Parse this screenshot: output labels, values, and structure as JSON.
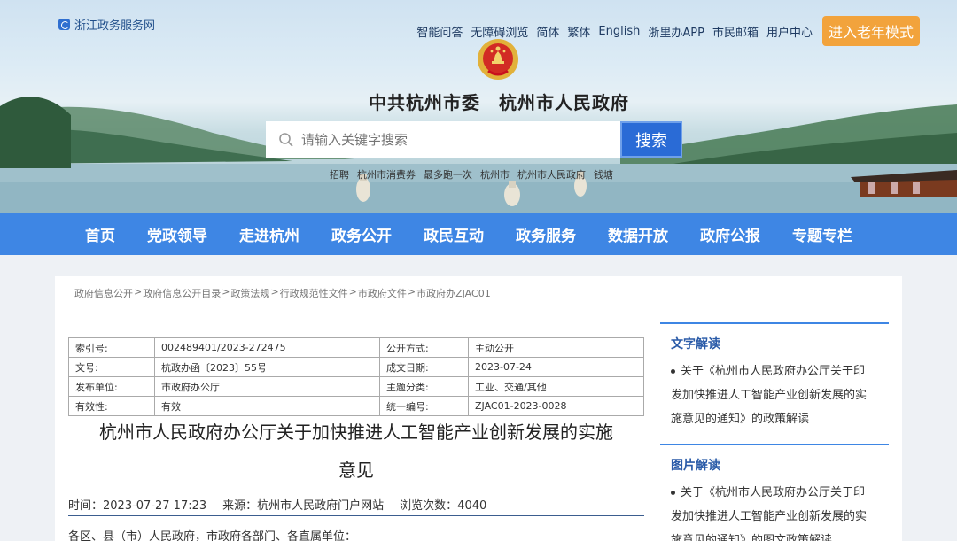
{
  "header": {
    "site_logo": "浙江政务服务网",
    "top_links": [
      "智能问答",
      "无障碍浏览",
      "简体",
      "繁体",
      "English",
      "浙里办APP",
      "市民邮箱",
      "用户中心"
    ],
    "elder_mode": "进入老年模式",
    "title": "中共杭州市委　杭州市人民政府",
    "search_placeholder": "请输入关键字搜索",
    "search_button": "搜索",
    "hot_words": [
      "招聘",
      "杭州市消费券",
      "最多跑一次",
      "杭州市",
      "杭州市人民政府",
      "钱塘"
    ]
  },
  "nav": {
    "items": [
      "首页",
      "党政领导",
      "走进杭州",
      "政务公开",
      "政民互动",
      "政务服务",
      "数据开放",
      "政府公报",
      "专题专栏"
    ]
  },
  "breadcrumb": [
    "政府信息公开",
    "政府信息公开目录",
    "政策法规",
    "行政规范性文件",
    "市政府文件",
    "市政府办ZJAC01"
  ],
  "meta": {
    "rows": [
      [
        "索引号:",
        "002489401/2023-272475",
        "公开方式:",
        "主动公开"
      ],
      [
        "文号:",
        "杭政办函〔2023〕55号",
        "成文日期:",
        "2023-07-24"
      ],
      [
        "发布单位:",
        "市政府办公厅",
        "主题分类:",
        "工业、交通/其他"
      ],
      [
        "有效性:",
        "有效",
        "统一编号:",
        "ZJAC01-2023-0028"
      ]
    ]
  },
  "article": {
    "title_line1": "杭州市人民政府办公厅关于加快推进人工智能产业创新发展的实施",
    "title_line2": "意见",
    "time": "时间：2023-07-27 17:23",
    "source": "来源：杭州市人民政府门户网站",
    "views": "浏览次数：4040",
    "body_start": "各区、县（市）人民政府，市政府各部门、各直属单位："
  },
  "sidebar": {
    "text_section_title": "文字解读",
    "text_item_lines": [
      "关于《杭州市人民政府办公厅关于印",
      "发加快推进人工智能产业创新发展的实",
      "施意见的通知》的政策解读"
    ],
    "image_section_title": "图片解读",
    "image_item_lines": [
      "关于《杭州市人民政府办公厅关于印",
      "发加快推进人工智能产业创新发展的实",
      "施意见的通知》的图文政策解读"
    ]
  },
  "colors": {
    "nav_bg": "#3e86e4",
    "elder_btn": "#f2a33c",
    "search_btn": "#2a6bd6"
  },
  "icons": [
    "logo-icon",
    "national-emblem-icon",
    "search-icon"
  ]
}
